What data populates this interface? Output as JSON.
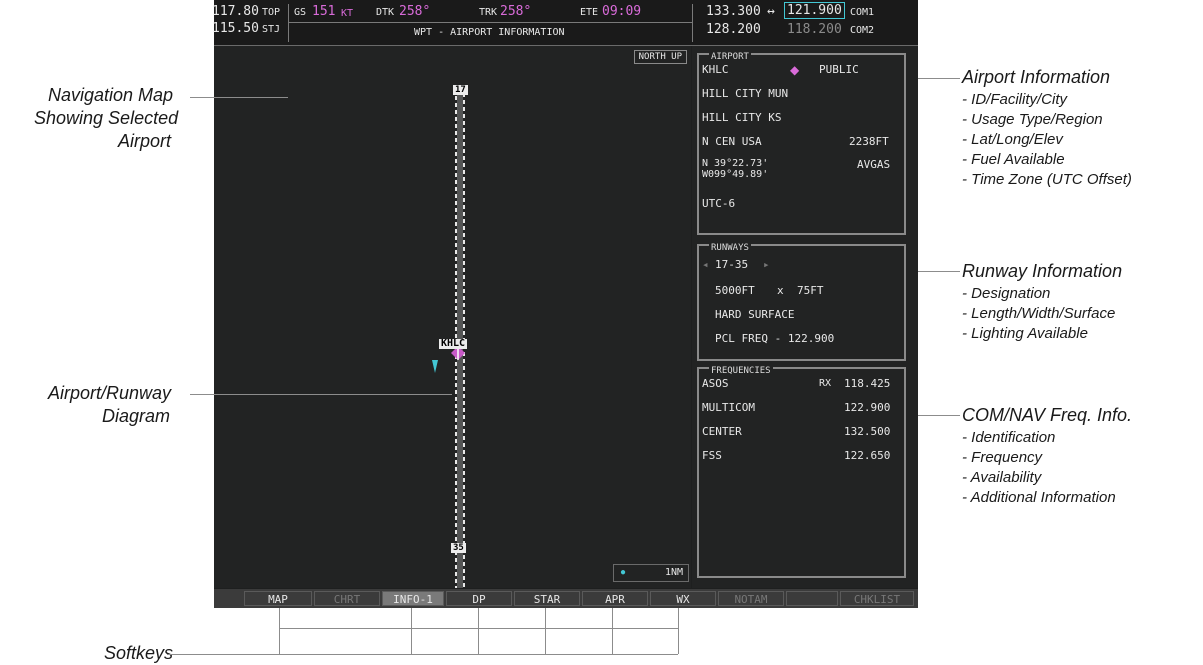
{
  "topbar": {
    "nav1_freq": "117.80",
    "nav2_freq": "115.50",
    "wpt_top": "TOP",
    "wpt_stj": "STJ",
    "gs_label": "GS",
    "gs_value": "151",
    "gs_unit": "KT",
    "dtk_label": "DTK",
    "dtk_value": "258°",
    "trk_label": "TRK",
    "trk_value": "258°",
    "ete_label": "ETE",
    "ete_value": "09:09",
    "page_title": "WPT - AIRPORT INFORMATION",
    "com1_active": "133.300",
    "com1_swap": "↔",
    "com1_standby": "121.900",
    "com1_label": "COM1",
    "com2_active": "128.200",
    "com2_standby": "118.200",
    "com2_label": "COM2"
  },
  "map": {
    "orientation": "NORTH UP",
    "runway_top": "17",
    "runway_bottom": "35",
    "airport_label": "KHLC",
    "range": "1NM"
  },
  "airport": {
    "title": "AIRPORT",
    "id": "KHLC",
    "usage": "PUBLIC",
    "facility": "HILL CITY MUN",
    "city": "HILL CITY KS",
    "region": "N CEN USA",
    "elevation": "2238FT",
    "lat": "N 39°22.73'",
    "lon": "W099°49.89'",
    "fuel": "AVGAS",
    "timezone": "UTC-6"
  },
  "runways": {
    "title": "RUNWAYS",
    "designation": "17-35",
    "length": "5000FT",
    "by": "x",
    "width": "75FT",
    "surface": "HARD SURFACE",
    "lighting": "PCL FREQ -  122.900"
  },
  "frequencies": {
    "title": "FREQUENCIES",
    "items": [
      {
        "name": "ASOS",
        "prefix": "RX",
        "freq": "118.425"
      },
      {
        "name": "MULTICOM",
        "prefix": "",
        "freq": "122.900"
      },
      {
        "name": "CENTER",
        "prefix": "",
        "freq": "132.500"
      },
      {
        "name": "FSS",
        "prefix": "",
        "freq": "122.650"
      }
    ]
  },
  "softkeys": [
    "MAP",
    "CHRT",
    "INFO-1",
    "DP",
    "STAR",
    "APR",
    "WX",
    "NOTAM",
    "",
    "CHKLIST"
  ],
  "callouts": {
    "nav_map": [
      "Navigation Map",
      "Showing Selected",
      "Airport"
    ],
    "diagram": [
      "Airport/Runway",
      "Diagram"
    ],
    "softkeys": "Softkeys",
    "airport_info": {
      "title": "Airport Information",
      "items": [
        "- ID/Facility/City",
        "- Usage Type/Region",
        "- Lat/Long/Elev",
        "- Fuel Available",
        "- Time Zone (UTC Offset)"
      ]
    },
    "runway_info": {
      "title": "Runway Information",
      "items": [
        "- Designation",
        "- Length/Width/Surface",
        "- Lighting Available"
      ]
    },
    "freq_info": {
      "title": "COM/NAV Freq. Info.",
      "items": [
        "- Identification",
        "- Frequency",
        "- Availability",
        "- Additional Information"
      ]
    }
  },
  "colors": {
    "magenta": "#d96bd9",
    "cyan": "#43c7d4",
    "screen_bg": "#222323"
  }
}
